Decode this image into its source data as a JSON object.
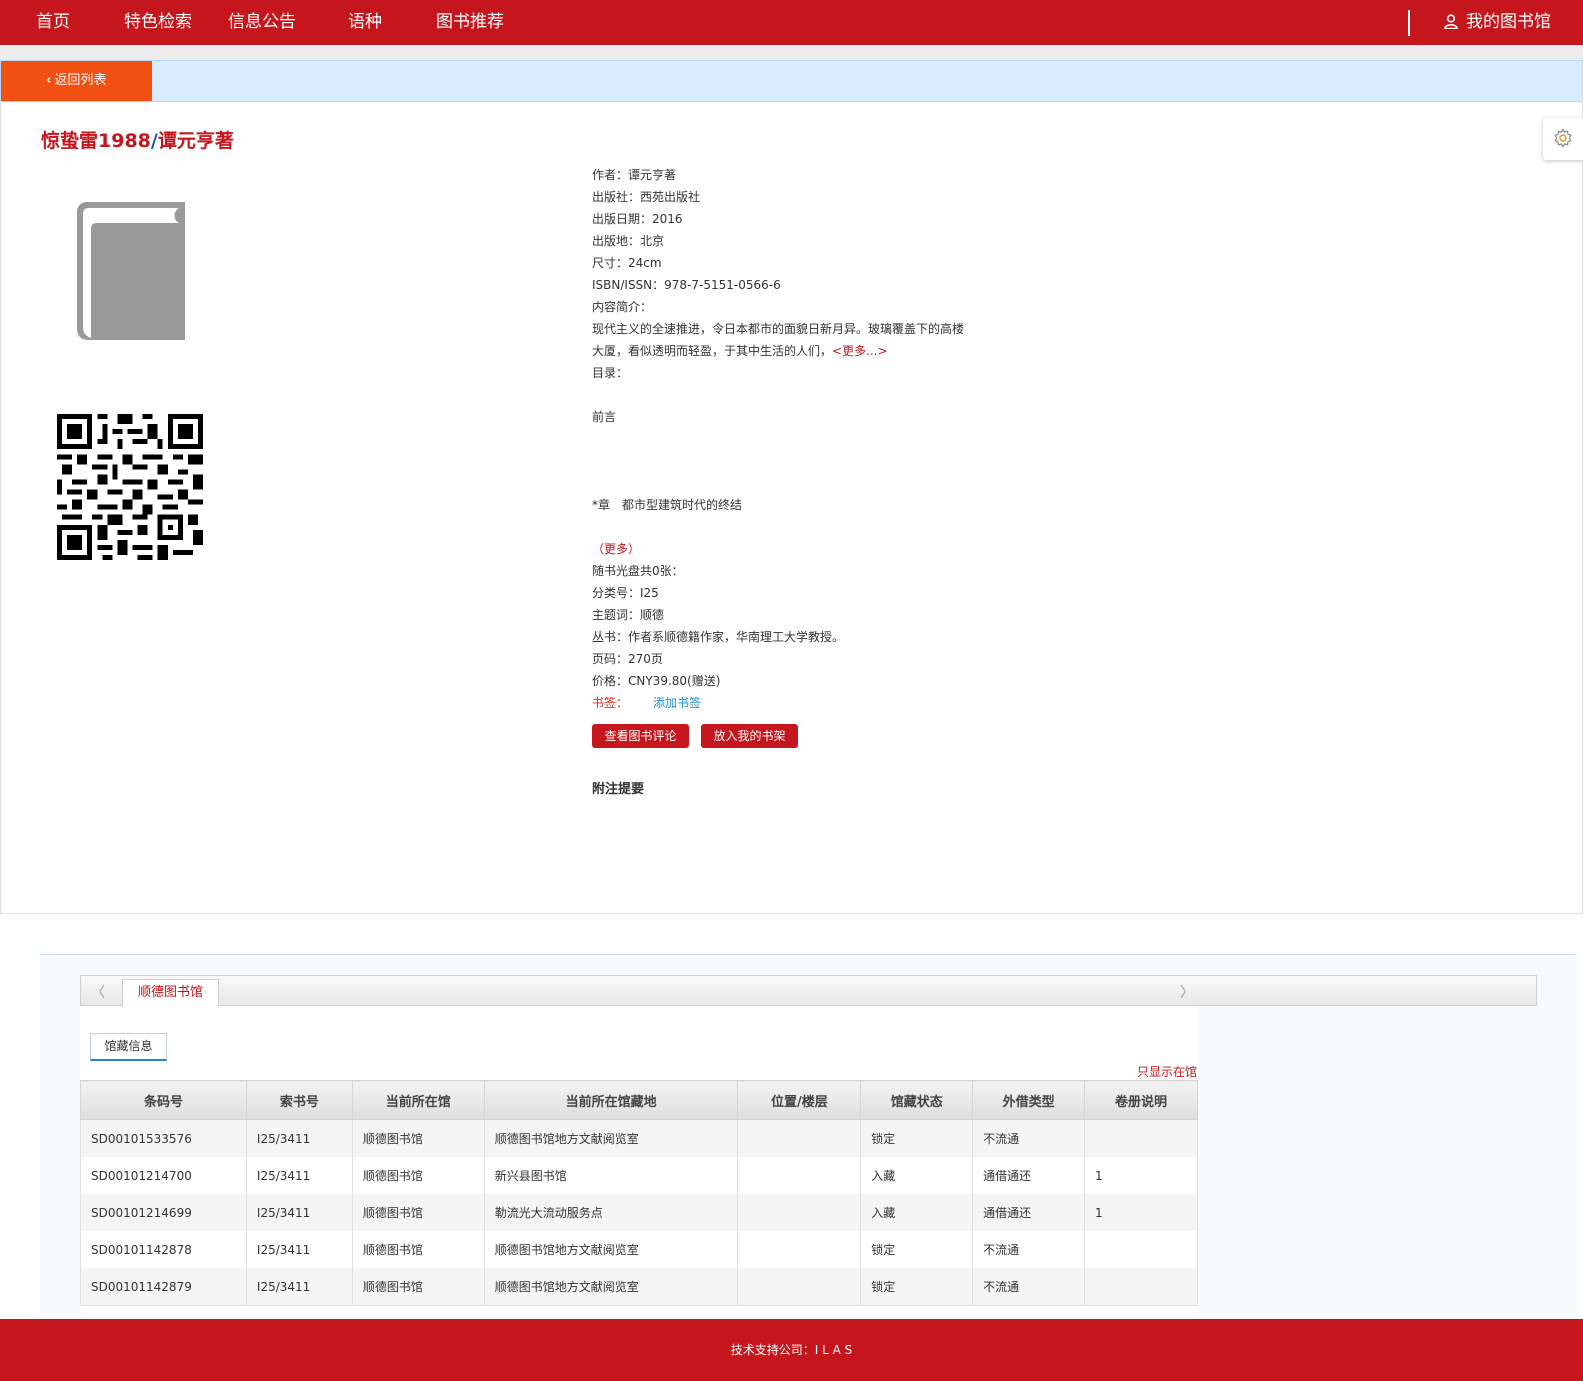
{
  "nav": {
    "items": [
      "首页",
      "特色检索",
      "信息公告",
      "语种",
      "图书推荐"
    ],
    "my_library": "我的图书馆"
  },
  "back_button": "返回列表",
  "book": {
    "title": "惊蛰雷1988",
    "slash": "/",
    "author_stmt": "谭元亨著"
  },
  "details": {
    "author": "作者：谭元亨著",
    "publisher": "出版社：西苑出版社",
    "pub_date": "出版日期：2016",
    "pub_place": "出版地：北京",
    "size": "尺寸：24cm",
    "isbn": "ISBN/ISSN：978-7-5151-0566-6",
    "summary_label": "内容简介：",
    "summary_line1": "现代主义的全速推进，令日本都市的面貌日新月异。玻璃覆盖下的高楼",
    "summary_line2": "大厦，看似透明而轻盈，于其中生活的人们，",
    "summary_more": "<更多...>",
    "toc_label": "目录：",
    "toc_line1": "前言",
    "toc_line2": "*章　都市型建筑时代的终结",
    "toc_more_open": "（",
    "toc_more": "更多",
    "toc_more_close": "）",
    "disc": "随书光盘共0张：",
    "class_no": "分类号：I25",
    "subject": "主题词：顺德",
    "series": "丛书：作者系顺德籍作家，华南理工大学教授。",
    "pages": "页码：270页",
    "price": "价格：CNY39.80(赠送)",
    "bookmark_label": "书签：",
    "bookmark_add": "添加书签"
  },
  "buttons": {
    "view_reviews": "查看图书评论",
    "add_shelf": "放入我的书架"
  },
  "notes_title": "附注提要",
  "holdings": {
    "library_tab": "顺德图书馆",
    "sub_tab": "馆藏信息",
    "only_in_library": "只显示在馆",
    "columns": [
      "条码号",
      "索书号",
      "当前所在馆",
      "当前所在馆藏地",
      "位置/楼层",
      "馆藏状态",
      "外借类型",
      "卷册说明"
    ],
    "rows": [
      [
        "SD00101533576",
        "I25/3411",
        "顺德图书馆",
        "顺德图书馆地方文献阅览室",
        "",
        "锁定",
        "不流通",
        ""
      ],
      [
        "SD00101214700",
        "I25/3411",
        "顺德图书馆",
        "新兴县图书馆",
        "",
        "入藏",
        "通借通还",
        "1"
      ],
      [
        "SD00101214699",
        "I25/3411",
        "顺德图书馆",
        "勒流光大流动服务点",
        "",
        "入藏",
        "通借通还",
        "1"
      ],
      [
        "SD00101142878",
        "I25/3411",
        "顺德图书馆",
        "顺德图书馆地方文献阅览室",
        "",
        "锁定",
        "不流通",
        ""
      ],
      [
        "SD00101142879",
        "I25/3411",
        "顺德图书馆",
        "顺德图书馆地方文献阅览室",
        "",
        "锁定",
        "不流通",
        ""
      ]
    ]
  },
  "footer": "技术支持公司：I L A S",
  "colors": {
    "brand_red": "#c4161c",
    "back_orange": "#f24f12",
    "link_blue": "#1a8fe0"
  }
}
